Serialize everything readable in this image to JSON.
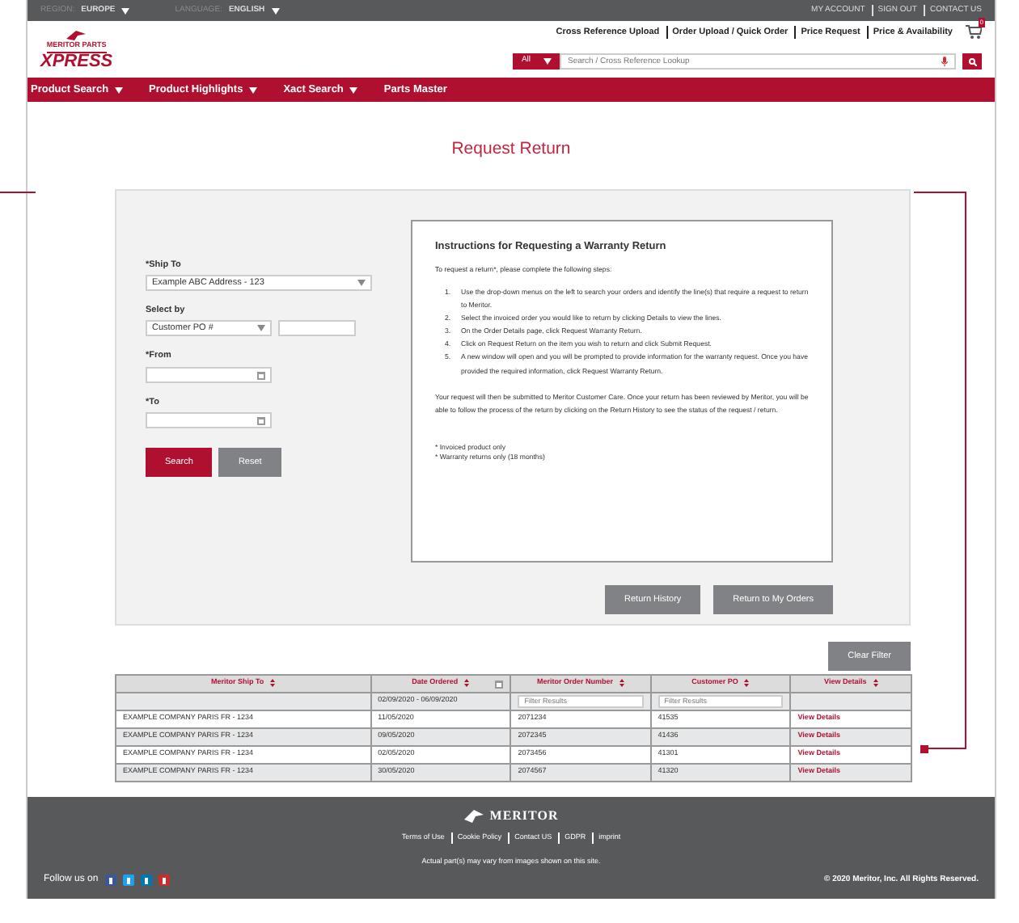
{
  "top_bar": {
    "region_label": "REGION:",
    "region": "EUROPE",
    "language_label": "LANGUAGE:",
    "language": "ENGLISH",
    "links": [
      "MY ACCOUNT",
      "SIGN OUT",
      "CONTACT US"
    ]
  },
  "header": {
    "logo": {
      "line1": "MERITOR PARTS",
      "line2": "XPRESS"
    },
    "links": [
      "Cross Reference Upload",
      "Order Upload / Quick Order",
      "Price Request",
      "Price & Availability"
    ],
    "cart_count": "0",
    "search": {
      "scope": "All",
      "placeholder": "Search / Cross Reference Lookup"
    }
  },
  "nav": [
    {
      "label": "Product Search",
      "dropdown": true
    },
    {
      "label": "Product Highlights",
      "dropdown": true
    },
    {
      "label": "Xact Search",
      "dropdown": true
    },
    {
      "label": "Parts Master",
      "dropdown": false
    }
  ],
  "page_title": "Request Return",
  "form": {
    "ship_to": {
      "label": "*Ship To",
      "value": "Example ABC Address - 123"
    },
    "select_by": {
      "label": "Select by",
      "value": "Customer PO #"
    },
    "from": {
      "label": "*From"
    },
    "to": {
      "label": "*To"
    },
    "buttons": [
      {
        "label": "Search",
        "kind": "primary"
      },
      {
        "label": "Reset",
        "kind": "secondary"
      }
    ]
  },
  "instructions": {
    "title": "Instructions for Requesting a Warranty Return",
    "intro": "To request a return*, please complete the following steps:",
    "steps": [
      {
        "number": "1.",
        "text": "Use the drop-down menus on the left to search your orders and identify the line(s) that require a request to return to Meritor."
      },
      {
        "number": "2.",
        "text": "Select the invoiced order you would like to return by clicking Details to view the lines."
      },
      {
        "number": "3.",
        "text": "On the Order Details page, click Request Warranty Return."
      },
      {
        "number": "4.",
        "text": "Click on Request Return on the item you wish to return and click Submit Request."
      },
      {
        "number": "5.",
        "text": "A new window will open and you will be prompted to provide information for the warranty request. Once you have provided the required information, click Request Warranty Return."
      }
    ],
    "paragraph": "Your request will then be submitted to Meritor Customer Care. Once your return has been reviewed by Meritor, you will be able to follow the process of the return by clicking on the Return History to see the status of the request / return.",
    "notes": [
      "* Invoiced product only",
      "* Warranty returns only (18 months)"
    ]
  },
  "actions": [
    "Return History",
    "Return to My Orders"
  ],
  "clear_filter": "Clear Filter",
  "table": {
    "columns": [
      {
        "label": "Meritor Ship To",
        "calendar": false
      },
      {
        "label": "Date Ordered",
        "calendar": true
      },
      {
        "label": "Meritor Order Number",
        "calendar": false
      },
      {
        "label": "Customer PO",
        "calendar": false
      },
      {
        "label": "View Details",
        "calendar": false
      }
    ],
    "filters": [
      {
        "kind": "empty"
      },
      {
        "kind": "text",
        "value": "02/09/2020 - 06/09/2020"
      },
      {
        "kind": "input",
        "placeholder": "Filter Results"
      },
      {
        "kind": "input",
        "placeholder": "Filter Results"
      },
      {
        "kind": "empty"
      }
    ],
    "rows": [
      [
        "EXAMPLE COMPANY PARIS FR - 1234",
        "11/05/2020",
        "2071234",
        "41535",
        "View Details"
      ],
      [
        "EXAMPLE COMPANY PARIS FR - 1234",
        "09/05/2020",
        "2072345",
        "41436",
        "View Details"
      ],
      [
        "EXAMPLE COMPANY PARIS FR - 1234",
        "02/05/2020",
        "2073456",
        "41301",
        "View Details"
      ],
      [
        "EXAMPLE COMPANY PARIS FR - 1234",
        "30/05/2020",
        "2074567",
        "41320",
        "View Details"
      ]
    ]
  },
  "footer": {
    "brand": "MERITOR",
    "links": [
      "Terms of Use",
      "Cookie Policy",
      "Contact US",
      "GDPR",
      "imprint"
    ],
    "disclaimer": "Actual part(s) may vary from images shown on this site.",
    "follow": "Follow us on",
    "copyright": "© 2020 Meritor, Inc. All Rights Reserved."
  }
}
